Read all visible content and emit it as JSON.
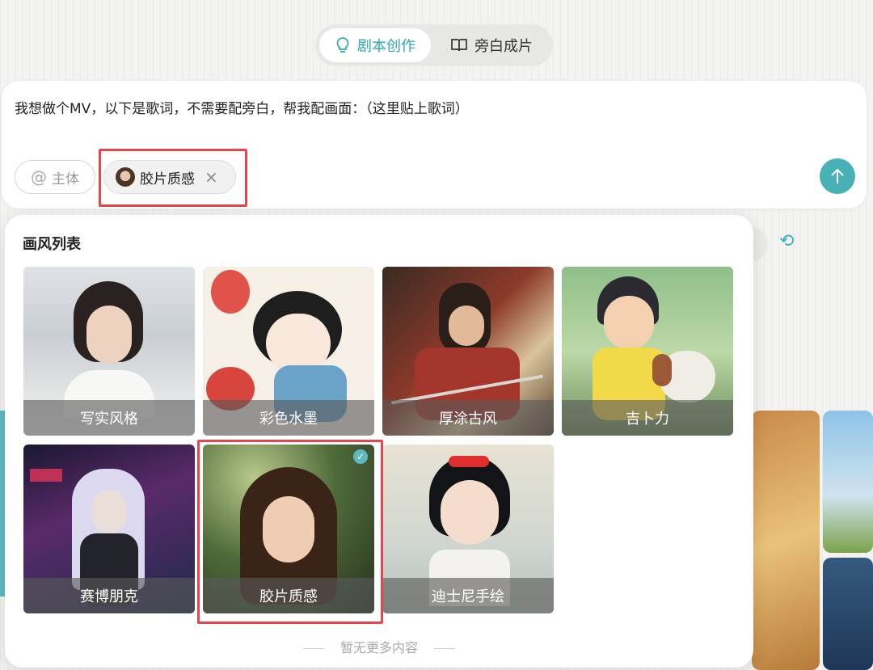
{
  "mode_tabs": [
    {
      "label": "剧本创作",
      "icon": "lightbulb-icon",
      "active": true
    },
    {
      "label": "旁白成片",
      "icon": "book-icon",
      "active": false
    }
  ],
  "prompt": {
    "text": "我想做个MV，以下是歌词，不需要配旁白，帮我配画面：（这里贴上歌词）",
    "subject_chip_label": "主体",
    "selected_style_chip_label": "胶片质感"
  },
  "panel": {
    "title": "画风列表",
    "footer": "暂无更多内容",
    "styles": [
      {
        "label": "写实风格",
        "selected": false
      },
      {
        "label": "彩色水墨",
        "selected": false
      },
      {
        "label": "厚涂古风",
        "selected": false
      },
      {
        "label": "吉卜力",
        "selected": false
      },
      {
        "label": "赛博朋克",
        "selected": false
      },
      {
        "label": "胶片质感",
        "selected": true
      },
      {
        "label": "迪士尼手绘",
        "selected": false
      }
    ]
  },
  "colors": {
    "accent": "#2fa9b2",
    "send_button": "#46b2b6",
    "highlight_box": "#e5454d"
  }
}
